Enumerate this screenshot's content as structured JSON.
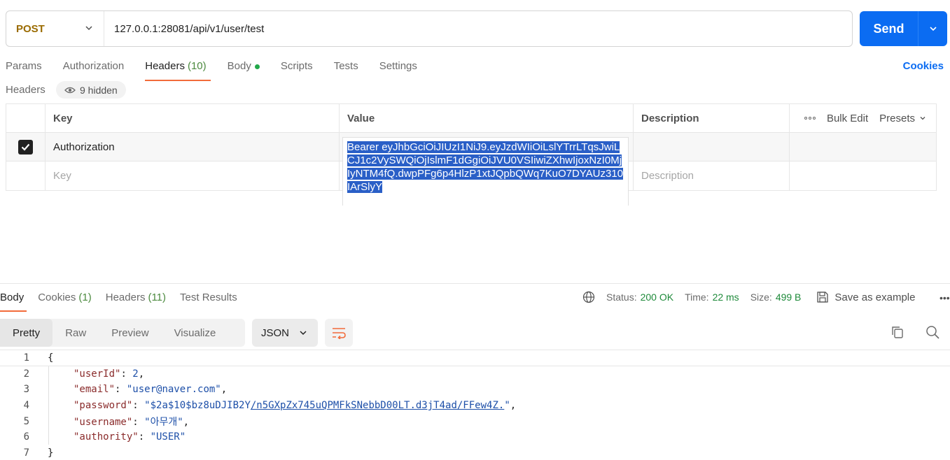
{
  "request": {
    "method": "POST",
    "url": "127.0.0.1:28081/api/v1/user/test",
    "send_label": "Send"
  },
  "request_tabs": [
    {
      "label": "Params"
    },
    {
      "label": "Authorization"
    },
    {
      "label": "Headers",
      "count": "(10)"
    },
    {
      "label": "Body"
    },
    {
      "label": "Scripts"
    },
    {
      "label": "Tests"
    },
    {
      "label": "Settings"
    }
  ],
  "cookies_label": "Cookies",
  "headers_section": {
    "title": "Headers",
    "hidden_label": "9 hidden",
    "columns": {
      "key": "Key",
      "value": "Value",
      "description": "Description"
    },
    "bulk_edit": "Bulk Edit",
    "presets": "Presets",
    "row": {
      "key": "Authorization",
      "checked": true
    },
    "placeholder_key": "Key",
    "placeholder_description": "Description",
    "expanded_value": "Bearer eyJhbGciOiJIUzI1NiJ9.eyJzdWIiOiLslYTrrLTqsJwiLCJ1c2VySWQiOjIslmF1dGgiOiJVU0VSIiwiZXhwIjoxNzI0MjIyNTM4fQ.dwpPFg6p4HlzP1xtJQpbQWq7KuO7DYAUz310IArSlyY"
  },
  "response_tabs": [
    {
      "label": "Body"
    },
    {
      "label": "Cookies",
      "count": "(1)"
    },
    {
      "label": "Headers",
      "count": "(11)"
    },
    {
      "label": "Test Results"
    }
  ],
  "response_meta": {
    "status_label": "Status:",
    "status_value": "200 OK",
    "time_label": "Time:",
    "time_value": "22 ms",
    "size_label": "Size:",
    "size_value": "499 B",
    "save_example": "Save as example"
  },
  "viewer_tabs": [
    {
      "label": "Pretty"
    },
    {
      "label": "Raw"
    },
    {
      "label": "Preview"
    },
    {
      "label": "Visualize"
    }
  ],
  "format": "JSON",
  "body_lines": {
    "l1": "{",
    "l7": "}",
    "userId_key": "\"userId\"",
    "userId_val": "2",
    "email_key": "\"email\"",
    "email_val": "\"user@naver.com\"",
    "password_key": "\"password\"",
    "password_val_prefix": "\"$2a$10$bz8uDJIB2Y",
    "password_val_link": "/n5GXpZx745uQPMFkSNebbD00LT.d3jT4ad/FFew4Z.",
    "password_val_suffix": "\"",
    "username_key": "\"username\"",
    "username_val": "\"아무개\"",
    "authority_key": "\"authority\"",
    "authority_val": "\"USER\""
  },
  "colors": {
    "accent": "#f26b3a",
    "send": "#0b6cf2",
    "method": "#9a6b00",
    "status_ok": "#1e8a3a"
  }
}
